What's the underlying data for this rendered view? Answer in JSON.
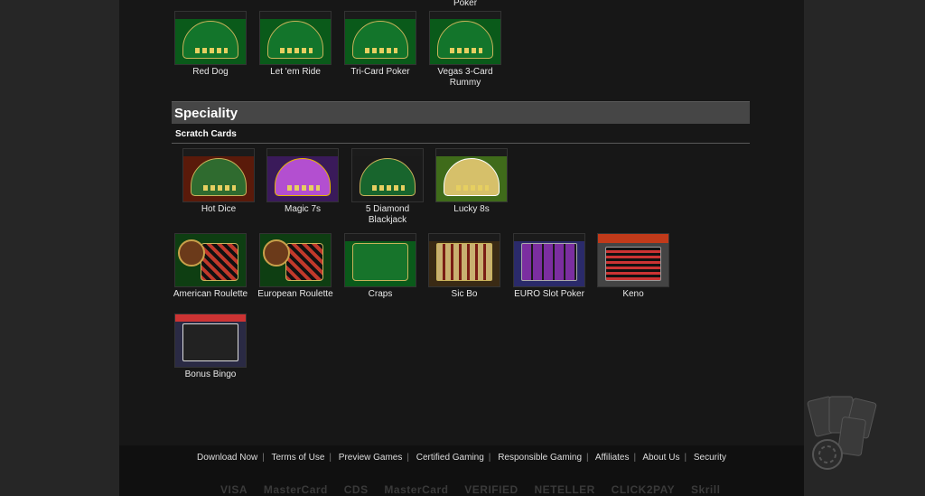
{
  "top_partial_label": "Poker",
  "top_games": [
    {
      "name": "Red Dog",
      "theme": "green"
    },
    {
      "name": "Let 'em Ride",
      "theme": "green"
    },
    {
      "name": "Tri-Card Poker",
      "theme": "green"
    },
    {
      "name": "Vegas 3-Card Rummy",
      "theme": "green"
    }
  ],
  "section": {
    "title": "Speciality",
    "subtitle": "Scratch Cards"
  },
  "scratch_cards": [
    {
      "name": "Hot Dice"
    },
    {
      "name": "Magic 7s"
    },
    {
      "name": "5 Diamond Blackjack"
    },
    {
      "name": "Lucky 8s"
    }
  ],
  "table_games": [
    {
      "name": "American Roulette"
    },
    {
      "name": "European Roulette"
    },
    {
      "name": "Craps"
    },
    {
      "name": "Sic Bo"
    },
    {
      "name": "EURO Slot Poker"
    },
    {
      "name": "Keno"
    }
  ],
  "other_games": [
    {
      "name": "Bonus Bingo"
    }
  ],
  "footer": {
    "links": [
      "Download Now",
      "Terms of Use",
      "Preview Games",
      "Certified Gaming",
      "Responsible Gaming",
      "Affiliates",
      "About Us",
      "Security"
    ],
    "payment_logos": [
      "VISA",
      "MasterCard",
      "CDS",
      "MasterCard",
      "VERIFIED",
      "NETELLER",
      "CLICK2PAY",
      "Skrill"
    ]
  },
  "icons": {
    "cards_logo": "cards-chip-icon"
  }
}
